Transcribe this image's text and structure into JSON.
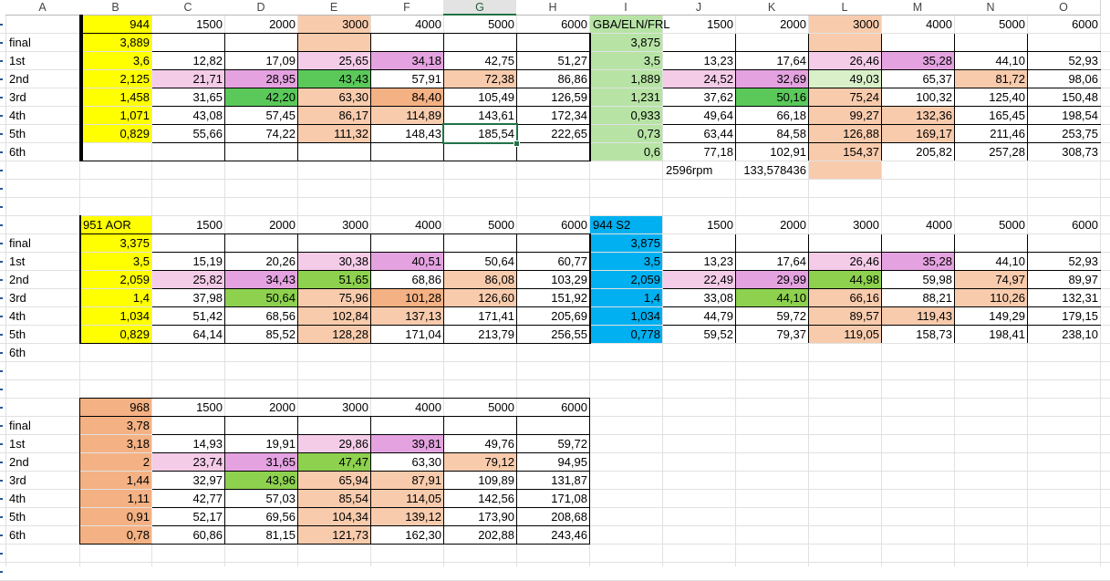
{
  "sheet": {
    "columns": [
      "A",
      "B",
      "C",
      "D",
      "E",
      "F",
      "G",
      "H",
      "I",
      "J",
      "K",
      "L",
      "M",
      "N",
      "O"
    ],
    "selected_column": "G",
    "row_labels_fragment": [
      "final",
      "1st",
      "2nd",
      "3rd",
      "4th",
      "5th",
      "6th"
    ],
    "colors": {
      "yellow": "#ffff00",
      "peach": "#f8cbad",
      "pink": "#f4cce8",
      "violet": "#e4a3e0",
      "green": "#5ac95a",
      "lightgreen": "#b7e4a5",
      "blue": "#00b0f0",
      "salmon": "#f4b183",
      "paleGreen": "#d9f0c8",
      "lime": "#8dd14f"
    },
    "blocks": [
      {
        "name": "block-944",
        "header": {
          "B": "944",
          "C": "1500",
          "D": "2000",
          "E": "3000",
          "F": "4000",
          "G": "5000",
          "H": "6000",
          "I": "GBA/ELN/FRL",
          "J": "1500",
          "K": "2000",
          "L": "3000",
          "M": "4000",
          "N": "5000",
          "O": "6000"
        },
        "rows": [
          {
            "A": "final",
            "B": "3,889",
            "I": "3,875"
          },
          {
            "A": "1st",
            "B": "3,6",
            "C": "12,82",
            "D": "17,09",
            "E": "25,65",
            "F": "34,18",
            "G": "42,75",
            "H": "51,27",
            "I": "3,5",
            "J": "13,23",
            "K": "17,64",
            "L": "26,46",
            "M": "35,28",
            "N": "44,10",
            "O": "52,93"
          },
          {
            "A": "2nd",
            "B": "2,125",
            "C": "21,71",
            "D": "28,95",
            "E": "43,43",
            "F": "57,91",
            "G": "72,38",
            "H": "86,86",
            "I": "1,889",
            "J": "24,52",
            "K": "32,69",
            "L": "49,03",
            "M": "65,37",
            "N": "81,72",
            "O": "98,06"
          },
          {
            "A": "3rd",
            "B": "1,458",
            "C": "31,65",
            "D": "42,20",
            "E": "63,30",
            "F": "84,40",
            "G": "105,49",
            "H": "126,59",
            "I": "1,231",
            "J": "37,62",
            "K": "50,16",
            "L": "75,24",
            "M": "100,32",
            "N": "125,40",
            "O": "150,48"
          },
          {
            "A": "4th",
            "B": "1,071",
            "C": "43,08",
            "D": "57,45",
            "E": "86,17",
            "F": "114,89",
            "G": "143,61",
            "H": "172,34",
            "I": "0,933",
            "J": "49,64",
            "K": "66,18",
            "L": "99,27",
            "M": "132,36",
            "N": "165,45",
            "O": "198,54"
          },
          {
            "A": "5th",
            "B": "0,829",
            "C": "55,66",
            "D": "74,22",
            "E": "111,32",
            "F": "148,43",
            "G": "185,54",
            "H": "222,65",
            "I": "0,73",
            "J": "63,44",
            "K": "84,58",
            "L": "126,88",
            "M": "169,17",
            "N": "211,46",
            "O": "253,75"
          },
          {
            "A": "6th",
            "I": "0,6",
            "J": "77,18",
            "K": "102,91",
            "L": "154,37",
            "M": "205,82",
            "N": "257,28",
            "O": "308,73"
          },
          {
            "J": "2596rpm",
            "K": "133,578436"
          }
        ]
      },
      {
        "name": "block-951",
        "header": {
          "B": "951 AOR",
          "C": "1500",
          "D": "2000",
          "E": "3000",
          "F": "4000",
          "G": "5000",
          "H": "6000",
          "I": "944 S2",
          "J": "1500",
          "K": "2000",
          "L": "3000",
          "M": "4000",
          "N": "5000",
          "O": "6000"
        },
        "rows": [
          {
            "A": "final",
            "B": "3,375",
            "I": "3,875"
          },
          {
            "A": "1st",
            "B": "3,5",
            "C": "15,19",
            "D": "20,26",
            "E": "30,38",
            "F": "40,51",
            "G": "50,64",
            "H": "60,77",
            "I": "3,5",
            "J": "13,23",
            "K": "17,64",
            "L": "26,46",
            "M": "35,28",
            "N": "44,10",
            "O": "52,93"
          },
          {
            "A": "2nd",
            "B": "2,059",
            "C": "25,82",
            "D": "34,43",
            "E": "51,65",
            "F": "68,86",
            "G": "86,08",
            "H": "103,29",
            "I": "2,059",
            "J": "22,49",
            "K": "29,99",
            "L": "44,98",
            "M": "59,98",
            "N": "74,97",
            "O": "89,97"
          },
          {
            "A": "3rd",
            "B": "1,4",
            "C": "37,98",
            "D": "50,64",
            "E": "75,96",
            "F": "101,28",
            "G": "126,60",
            "H": "151,92",
            "I": "1,4",
            "J": "33,08",
            "K": "44,10",
            "L": "66,16",
            "M": "88,21",
            "N": "110,26",
            "O": "132,31"
          },
          {
            "A": "4th",
            "B": "1,034",
            "C": "51,42",
            "D": "68,56",
            "E": "102,84",
            "F": "137,13",
            "G": "171,41",
            "H": "205,69",
            "I": "1,034",
            "J": "44,79",
            "K": "59,72",
            "L": "89,57",
            "M": "119,43",
            "N": "149,29",
            "O": "179,15"
          },
          {
            "A": "5th",
            "B": "0,829",
            "C": "64,14",
            "D": "85,52",
            "E": "128,28",
            "F": "171,04",
            "G": "213,79",
            "H": "256,55",
            "I": "0,778",
            "J": "59,52",
            "K": "79,37",
            "L": "119,05",
            "M": "158,73",
            "N": "198,41",
            "O": "238,10"
          },
          {
            "A": "6th"
          }
        ]
      },
      {
        "name": "block-968",
        "header": {
          "B": "968",
          "C": "1500",
          "D": "2000",
          "E": "3000",
          "F": "4000",
          "G": "5000",
          "H": "6000"
        },
        "rows": [
          {
            "A": "final",
            "B": "3,78"
          },
          {
            "A": "1st",
            "B": "3,18",
            "C": "14,93",
            "D": "19,91",
            "E": "29,86",
            "F": "39,81",
            "G": "49,76",
            "H": "59,72"
          },
          {
            "A": "2nd",
            "B": "2",
            "C": "23,74",
            "D": "31,65",
            "E": "47,47",
            "F": "63,30",
            "G": "79,12",
            "H": "94,95"
          },
          {
            "A": "3rd",
            "B": "1,44",
            "C": "32,97",
            "D": "43,96",
            "E": "65,94",
            "F": "87,91",
            "G": "109,89",
            "H": "131,87"
          },
          {
            "A": "4th",
            "B": "1,11",
            "C": "42,77",
            "D": "57,03",
            "E": "85,54",
            "F": "114,05",
            "G": "142,56",
            "H": "171,08"
          },
          {
            "A": "5th",
            "B": "0,91",
            "C": "52,17",
            "D": "69,56",
            "E": "104,34",
            "F": "139,12",
            "G": "173,90",
            "H": "208,68"
          },
          {
            "A": "6th",
            "B": "0,78",
            "C": "60,86",
            "D": "81,15",
            "E": "121,73",
            "F": "162,30",
            "G": "202,88",
            "H": "243,46"
          }
        ]
      }
    ],
    "active_cell": "G6"
  }
}
